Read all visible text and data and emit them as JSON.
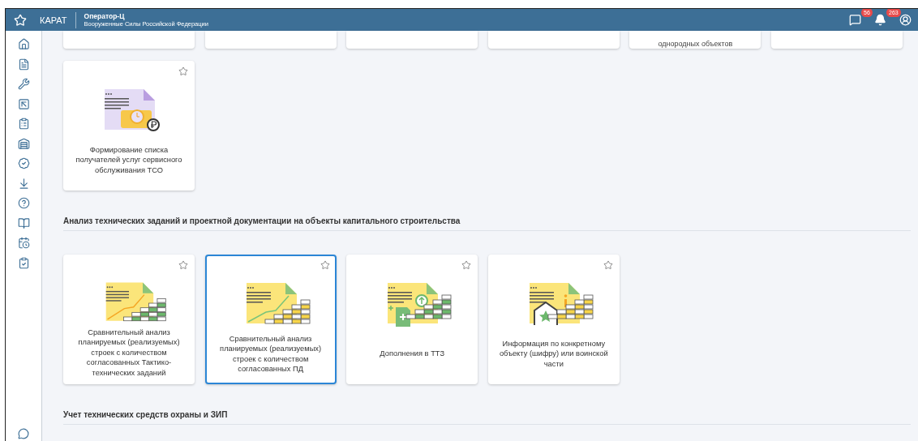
{
  "header": {
    "brand": "КАРАТ",
    "title": "Оператор-Ц",
    "subtitle": "Вооруженные Силы Российской Федерации",
    "messages_badge": "56",
    "notifications_badge": "263"
  },
  "sidebar": {
    "items": [
      {
        "kind": "home"
      },
      {
        "kind": "document"
      },
      {
        "kind": "wrench"
      },
      {
        "kind": "arrow"
      },
      {
        "kind": "form"
      },
      {
        "kind": "garage"
      },
      {
        "kind": "star"
      },
      {
        "kind": "download"
      },
      {
        "kind": "help"
      },
      {
        "kind": "book"
      },
      {
        "kind": "calendar"
      },
      {
        "kind": "clipboard"
      }
    ]
  },
  "top_cards": [
    {
      "kind": "blank"
    },
    {
      "kind": "blank"
    },
    {
      "kind": "blank"
    },
    {
      "kind": "blank"
    },
    {
      "kind": "text",
      "label": "однородных объектов"
    },
    {
      "kind": "blank"
    }
  ],
  "sections": [
    {
      "cards": [
        {
          "kind": "service",
          "label": "Формирование списка получателей услуг сервисного обслуживания ТСО",
          "selected": false
        }
      ]
    },
    {
      "title": "Анализ технических заданий и проектной документации на объекты капитального строительства",
      "cards": [
        {
          "kind": "bricks-green",
          "label": "Сравнительный анализ планируемых (реализуемых) строек с количеством согласованных Тактико-технических заданий",
          "selected": false
        },
        {
          "kind": "bricks-yellow",
          "label": "Сравнительный анализ планируемых (реализуемых) строек с количеством согласованных ПД",
          "selected": true
        },
        {
          "kind": "addition",
          "label": "Дополнения в ТТЗ",
          "selected": false
        },
        {
          "kind": "info",
          "label": "Информация по конкретному объекту (шифру) или воинской части",
          "selected": false
        }
      ]
    },
    {
      "title": "Учет технических средств охраны и ЗИП"
    }
  ]
}
